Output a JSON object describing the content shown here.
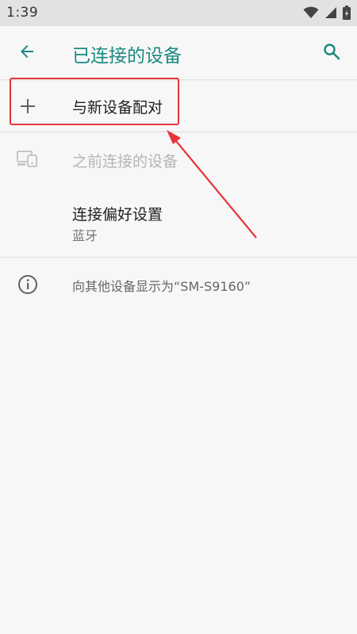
{
  "status_bar": {
    "time": "1:39",
    "icons": [
      "wifi-icon",
      "signal-icon",
      "battery-icon"
    ]
  },
  "app_bar": {
    "title": "已连接的设备",
    "back_icon": "arrow-left-icon",
    "search_icon": "search-icon",
    "accent_color": "#1b8a80"
  },
  "list": {
    "pair_new": {
      "label": "与新设备配对",
      "icon": "plus-icon"
    },
    "previously_connected": {
      "label": "之前连接的设备",
      "icon": "devices-icon"
    },
    "connection_prefs": {
      "label": "连接偏好设置",
      "sublabel": "蓝牙"
    },
    "visible_as": {
      "label": "向其他设备显示为“SM-S9160”",
      "icon": "info-icon"
    }
  },
  "annotation": {
    "highlight_color": "#e8343a"
  }
}
